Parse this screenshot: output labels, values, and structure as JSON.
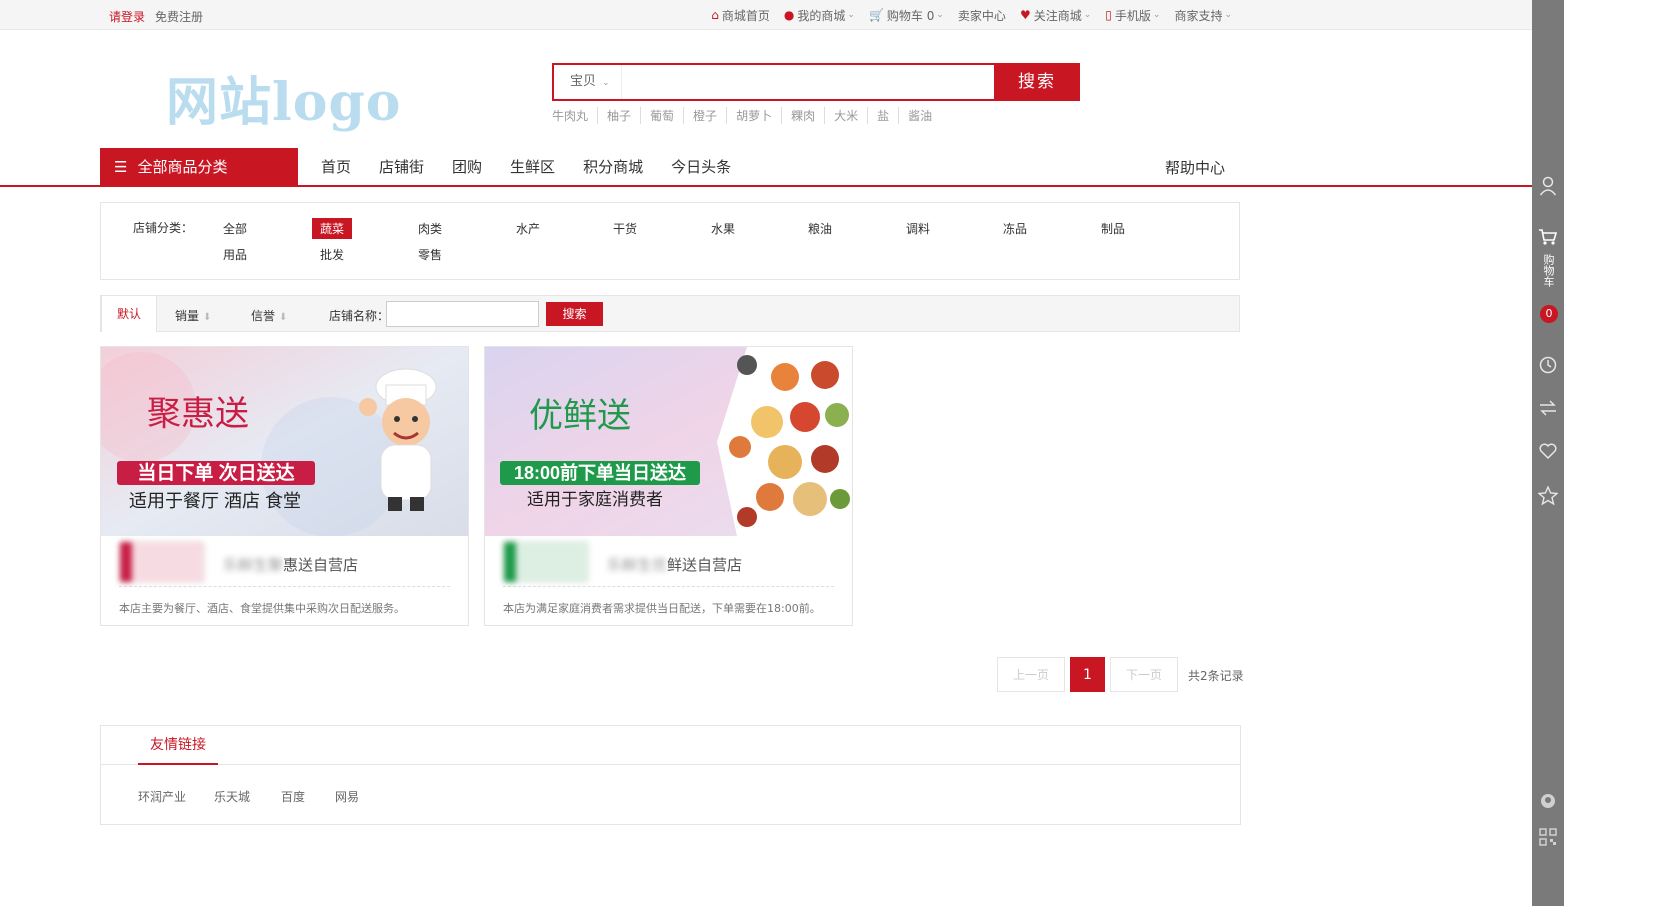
{
  "topbar": {
    "login": "请登录",
    "register": "免费注册",
    "links": [
      {
        "label": "商城首页",
        "icon": "home-icon",
        "glyph": "⌂",
        "dropdown": false
      },
      {
        "label": "我的商城",
        "icon": "user-icon",
        "glyph": "●",
        "dropdown": true
      },
      {
        "label": "购物车 0",
        "icon": "cart-icon",
        "glyph": "▼",
        "dropdown": true
      },
      {
        "label": "卖家中心",
        "icon": "",
        "glyph": "",
        "dropdown": false
      },
      {
        "label": "关注商城",
        "icon": "heart-icon",
        "glyph": "♥",
        "dropdown": true
      },
      {
        "label": "手机版",
        "icon": "mobile-icon",
        "glyph": "▯",
        "dropdown": true
      },
      {
        "label": "商家支持",
        "icon": "",
        "glyph": "",
        "dropdown": true
      }
    ]
  },
  "header": {
    "logo_text": "网站logo",
    "search": {
      "category": "宝贝",
      "placeholder": "",
      "button": "搜索"
    },
    "hot_words": [
      "牛肉丸",
      "柚子",
      "葡萄",
      "橙子",
      "胡萝卜",
      "粿肉",
      "大米",
      "盐",
      "酱油"
    ]
  },
  "nav": {
    "all_categories": "全部商品分类",
    "links": [
      "首页",
      "店铺街",
      "团购",
      "生鲜区",
      "积分商城",
      "今日头条"
    ],
    "help": "帮助中心"
  },
  "filter": {
    "label": "店铺分类：",
    "categories": [
      "全部",
      "蔬菜",
      "肉类",
      "水产",
      "干货",
      "水果",
      "粮油",
      "调料",
      "冻品",
      "制品",
      "用品",
      "批发",
      "零售"
    ],
    "active": "蔬菜"
  },
  "sortbar": {
    "default": "默认",
    "sales": "销量",
    "credit": "信誉",
    "shop_name_label": "店铺名称：",
    "search_button": "搜索"
  },
  "stores": [
    {
      "banner_brand": "聚惠送",
      "banner_slogan": "当日下单 次日送达",
      "banner_sub": "适用于餐厅 酒店 食堂",
      "name_prefix": "乐鲜生聚",
      "name_suffix": "惠送自营店",
      "description": "本店主要为餐厅、酒店、食堂提供集中采购次日配送服务。",
      "accent": "#c81e45"
    },
    {
      "banner_brand": "优鲜送",
      "banner_slogan": "18:00前下单当日送达",
      "banner_sub": "适用于家庭消费者",
      "name_prefix": "乐鲜生优",
      "name_suffix": "鲜送自营店",
      "description": "本店为满足家庭消费者需求提供当日配送，下单需要在18:00前。",
      "accent": "#1e9a4a"
    }
  ],
  "pagination": {
    "prev": "上一页",
    "current": "1",
    "next": "下一页",
    "total": "共2条记录"
  },
  "friend_links": {
    "title": "友情链接",
    "items": [
      "环润产业",
      "乐天城",
      "百度",
      "网易"
    ]
  },
  "sidebar": {
    "cart_label": "购物车",
    "cart_count": "0"
  },
  "colors": {
    "primary": "#c81623",
    "sidebar": "#7a7a7a"
  }
}
